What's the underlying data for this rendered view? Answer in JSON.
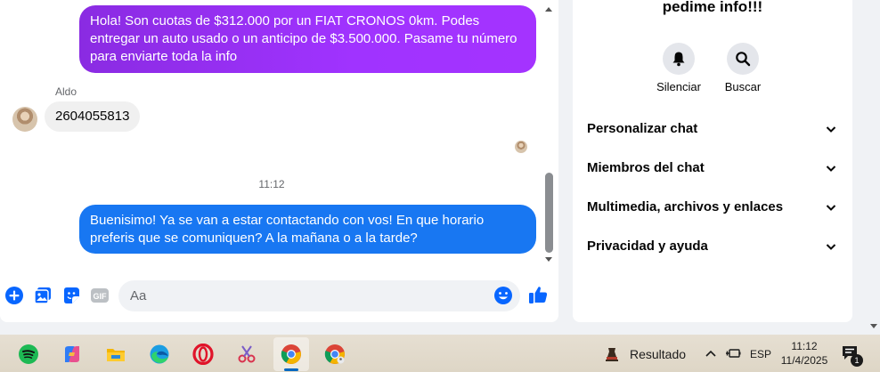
{
  "chat": {
    "messages": [
      {
        "direction": "outgoing",
        "text": "Hola! Son cuotas de $312.000 por un FIAT CRONOS 0km. Podes entregar un auto usado o un anticipo de $3.500.000. Pasame tu número para enviarte toda la info"
      },
      {
        "direction": "incoming",
        "sender": "Aldo",
        "text": "2604055813"
      },
      {
        "direction": "outgoing",
        "timestamp": "11:12",
        "text": "Buenisimo! Ya se van a estar contactando con vos! En que horario preferis que se comuniquen? A la mañana o a la tarde?"
      }
    ],
    "composer": {
      "placeholder": "Aa"
    },
    "composer_icons": [
      "plus-circle-icon",
      "photo-icon",
      "sticker-icon",
      "gif-icon",
      "emoji-icon",
      "like-icon"
    ],
    "colors": {
      "outgoing_gradient_start": "#8a2be2",
      "outgoing_gradient_end": "#a433ff",
      "outgoing_blue": "#1877f2",
      "incoming_bg": "#f0f0f0"
    }
  },
  "info": {
    "title": "pedime info!!!",
    "actions": [
      {
        "icon": "bell-icon",
        "label": "Silenciar"
      },
      {
        "icon": "search-icon",
        "label": "Buscar"
      }
    ],
    "sections": [
      {
        "label": "Personalizar chat"
      },
      {
        "label": "Miembros del chat"
      },
      {
        "label": "Multimedia, archivos y enlaces"
      },
      {
        "label": "Privacidad y ayuda"
      }
    ]
  },
  "taskbar": {
    "apps": [
      "spotify-icon",
      "copilot-icon",
      "file-explorer-icon",
      "edge-icon",
      "opera-icon",
      "snipping-tool-icon",
      "chrome-icon",
      "chrome-profile-icon"
    ],
    "widget_label": "Resultado",
    "language": "ESP",
    "time": "11:12",
    "date": "11/4/2025",
    "notification_count": "1"
  }
}
